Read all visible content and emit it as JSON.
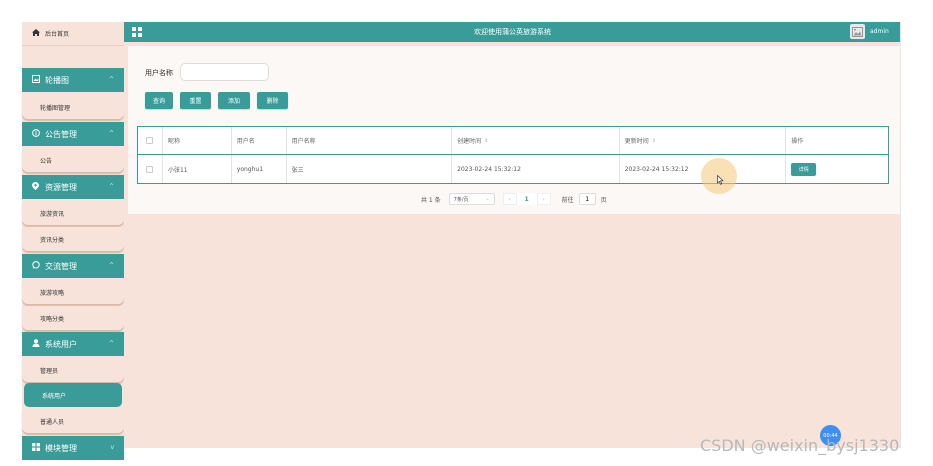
{
  "sidebar": {
    "home": {
      "label": "后台首页",
      "icon": "home-icon"
    },
    "groups": [
      {
        "label": "轮播图",
        "icon": "image-icon",
        "items": [
          "轮播图管理"
        ]
      },
      {
        "label": "公告管理",
        "icon": "info-circle-icon",
        "items": [
          "公告"
        ]
      },
      {
        "label": "资源管理",
        "icon": "location-pin-icon",
        "items": [
          "旅游资讯",
          "资讯分类"
        ]
      },
      {
        "label": "交流管理",
        "icon": "chat-bubble-icon",
        "items": [
          "旅游攻略",
          "攻略分类"
        ]
      },
      {
        "label": "系统用户",
        "icon": "user-icon",
        "items": [
          "管理员",
          "系统用户",
          "普通人员"
        ]
      },
      {
        "label": "模块管理",
        "icon": "grid-icon",
        "items": []
      }
    ],
    "active_item": "系统用户"
  },
  "header": {
    "title": "欢迎使用蒲公英旅游系统",
    "username": "admin"
  },
  "search": {
    "label": "用户名称",
    "value": "",
    "placeholder": ""
  },
  "actions": {
    "query": "查询",
    "reset": "重置",
    "add": "添加",
    "delete": "删除"
  },
  "table": {
    "columns": [
      "昵称",
      "用户名",
      "用户名称",
      "创建时间",
      "更新时间",
      "操作"
    ],
    "rows": [
      {
        "nickname": "小张11",
        "username": "yonghu1",
        "name": "张三",
        "created": "2023-02-24 15:32:12",
        "updated": "2023-02-24 15:32:12",
        "action": "详情"
      }
    ]
  },
  "pagination": {
    "total": "共 1 条",
    "page_size": "7条/页",
    "current_page": "1",
    "goto_label": "前往",
    "goto_value": "1",
    "page_unit": "页"
  },
  "overlay": {
    "badge": "00:44",
    "watermark": "CSDN @weixin_bysj1330"
  },
  "colors": {
    "primary": "#3a9c98",
    "background": "#f7e3da"
  }
}
